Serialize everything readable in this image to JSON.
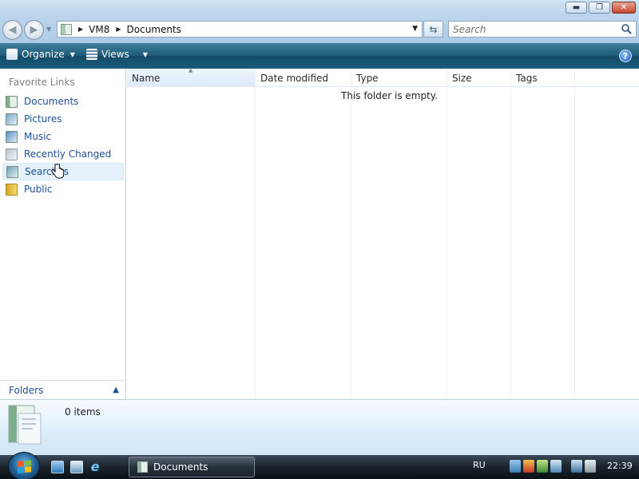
{
  "window": {
    "min_glyph": "▬",
    "max_glyph": "❐",
    "close_glyph": "✕"
  },
  "address": {
    "crumbs": [
      "VM8",
      "Documents"
    ]
  },
  "search": {
    "placeholder": "Search"
  },
  "toolbar": {
    "organize_label": "Organize",
    "views_label": "Views",
    "help_glyph": "?"
  },
  "nav": {
    "heading": "Favorite Links",
    "items": [
      {
        "label": "Documents",
        "icon": "documents-icon"
      },
      {
        "label": "Pictures",
        "icon": "pictures-icon"
      },
      {
        "label": "Music",
        "icon": "music-icon"
      },
      {
        "label": "Recently Changed",
        "icon": "recently-changed-icon"
      },
      {
        "label": "Searches",
        "icon": "searches-icon"
      },
      {
        "label": "Public",
        "icon": "public-folder-icon"
      }
    ],
    "folders_label": "Folders"
  },
  "columns": [
    "Name",
    "Date modified",
    "Type",
    "Size",
    "Tags"
  ],
  "content": {
    "empty_message": "This folder is empty."
  },
  "details": {
    "count": "0 items"
  },
  "taskbar": {
    "task_label": "Documents",
    "language": "RU",
    "clock": "22:39"
  }
}
